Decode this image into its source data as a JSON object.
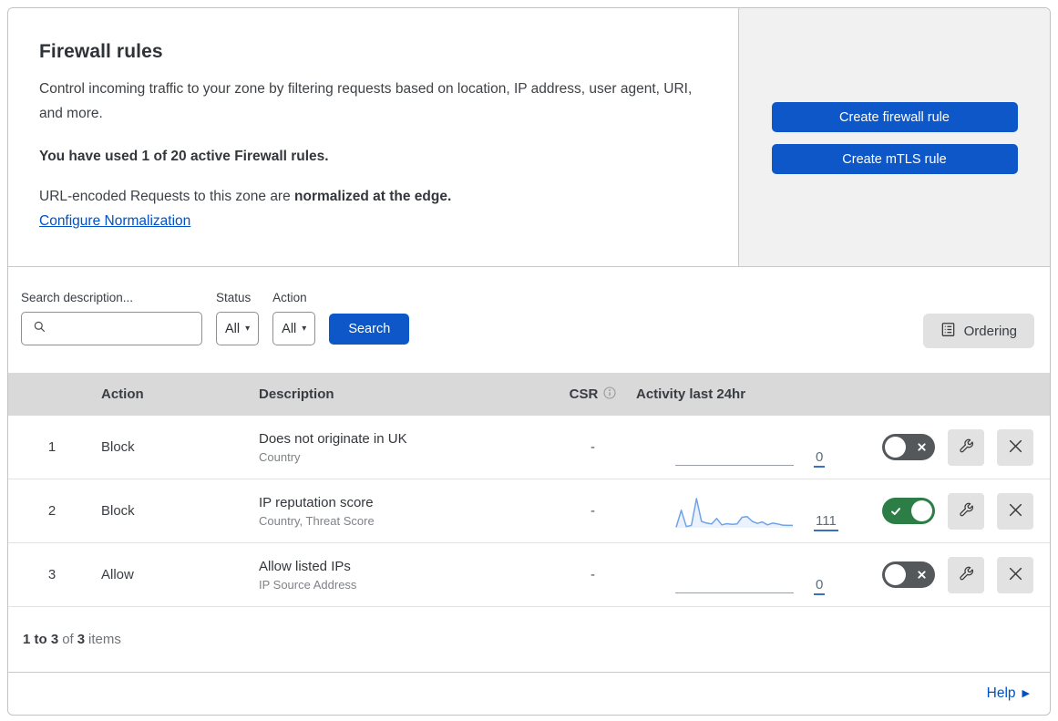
{
  "header": {
    "title": "Firewall rules",
    "description": "Control incoming traffic to your zone by filtering requests based on location, IP address, user agent, URI, and more.",
    "usage_bold": "You have used 1 of 20 active Firewall rules.",
    "normalization_prefix": "URL-encoded Requests to this zone are ",
    "normalization_bold": "normalized at the edge.",
    "normalization_link": "Configure Normalization",
    "buttons": {
      "create_firewall": "Create firewall rule",
      "create_mtls": "Create mTLS rule"
    }
  },
  "filters": {
    "search_label": "Search description...",
    "search_value": "",
    "status_label": "Status",
    "status_value": "All",
    "action_label": "Action",
    "action_value": "All",
    "search_button": "Search",
    "ordering_button": "Ordering"
  },
  "table": {
    "columns": {
      "action": "Action",
      "description": "Description",
      "csr": "CSR",
      "activity": "Activity last 24hr"
    },
    "rows": [
      {
        "num": "1",
        "action": "Block",
        "description": "Does not originate in UK",
        "criteria": "Country",
        "csr": "-",
        "activity_count": "0",
        "enabled": false,
        "sparkline": null
      },
      {
        "num": "2",
        "action": "Block",
        "description": "IP reputation score",
        "criteria": "Country, Threat Score",
        "csr": "-",
        "activity_count": "111",
        "enabled": true,
        "sparkline": [
          2,
          60,
          4,
          8,
          100,
          22,
          16,
          13,
          32,
          10,
          14,
          12,
          13,
          36,
          38,
          22,
          15,
          20,
          10,
          16,
          13,
          9,
          8,
          8
        ]
      },
      {
        "num": "3",
        "action": "Allow",
        "description": "Allow listed IPs",
        "criteria": "IP Source Address",
        "csr": "-",
        "activity_count": "0",
        "enabled": false,
        "sparkline": null
      }
    ]
  },
  "footer": {
    "range": "1 to 3",
    "of_label": "of",
    "total": "3",
    "items_label": "items"
  },
  "help": {
    "label": "Help"
  },
  "icons": {
    "dropdown_arrow": "▾",
    "help_arrow": "▶",
    "search_icon": "magnifier",
    "ordering_icon": "list-document",
    "info_icon": "info-circle",
    "edit_icon": "wrench",
    "delete_icon": "x",
    "toggle_on_icon": "check",
    "toggle_off_icon": "x"
  },
  "colors": {
    "primary_blue": "#0d57c9",
    "link_blue": "#0051c3",
    "toggle_on_green": "#2c7d46",
    "toggle_off_gray": "#55585a",
    "sparkline_blue": "#6ea3e8",
    "table_header_gray": "#d9d9d9",
    "sidebar_gray": "#f1f1f2"
  }
}
